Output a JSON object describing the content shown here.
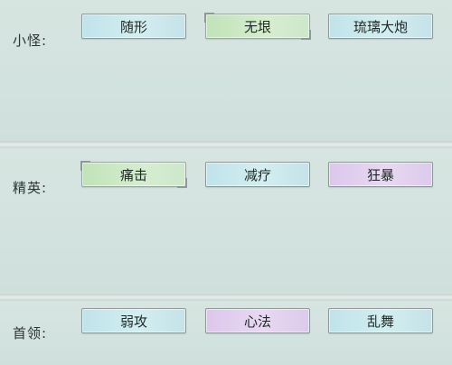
{
  "rows": [
    {
      "label": "小怪:",
      "buttons": [
        {
          "text": "随形",
          "color": "blue",
          "selected": false
        },
        {
          "text": "无垠",
          "color": "green",
          "selected": true
        },
        {
          "text": "琉璃大炮",
          "color": "blue",
          "selected": false
        }
      ]
    },
    {
      "label": "精英:",
      "buttons": [
        {
          "text": "痛击",
          "color": "green",
          "selected": true
        },
        {
          "text": "减疗",
          "color": "blue",
          "selected": false
        },
        {
          "text": "狂暴",
          "color": "purple",
          "selected": false
        }
      ]
    },
    {
      "label": "首领:",
      "buttons": [
        {
          "text": "弱攻",
          "color": "blue",
          "selected": false
        },
        {
          "text": "心法",
          "color": "purple",
          "selected": false
        },
        {
          "text": "乱舞",
          "color": "blue",
          "selected": false
        }
      ]
    }
  ],
  "colors": {
    "background": "#d6e3df",
    "blue": "#c4e2e8",
    "green": "#cde7cb",
    "purple": "#e0cfee"
  }
}
